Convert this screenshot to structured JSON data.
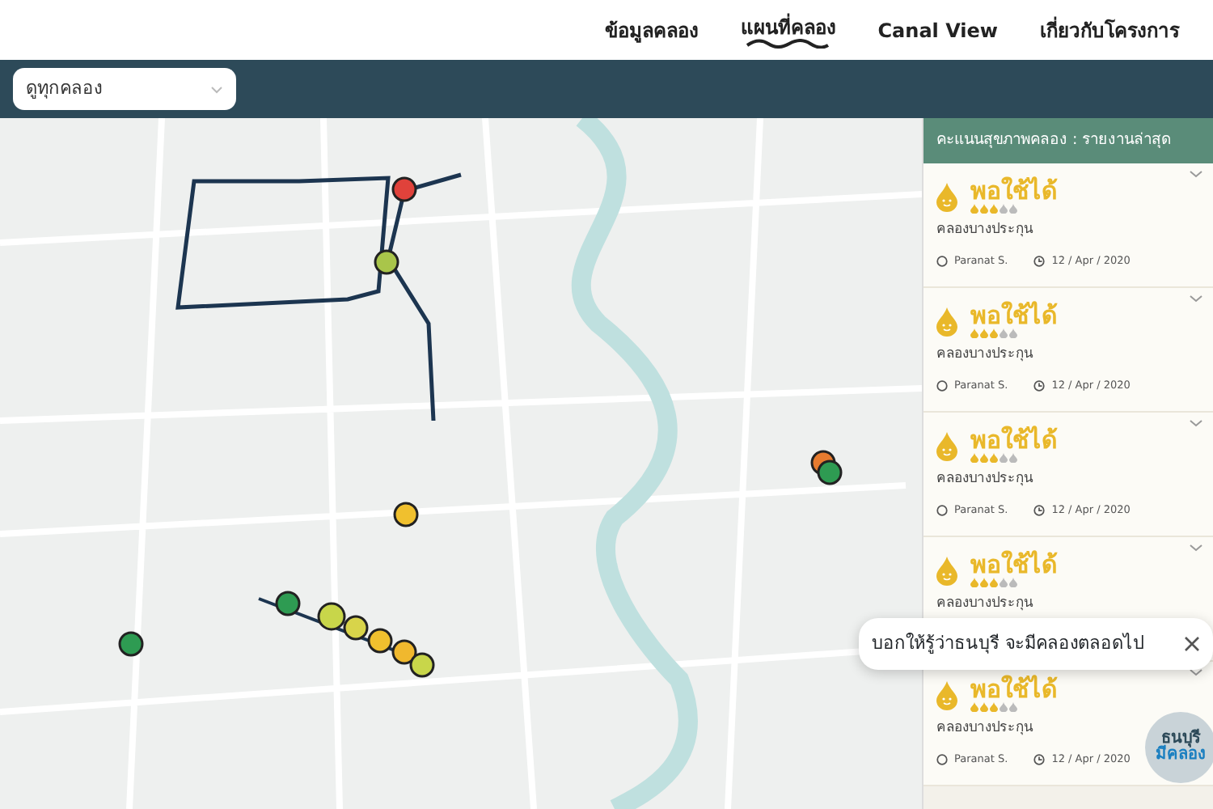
{
  "nav": {
    "items": [
      {
        "label": "ข้อมูลคลอง",
        "selected": false
      },
      {
        "label": "แผนที่คลอง",
        "selected": true
      },
      {
        "label": "Canal View",
        "selected": false
      },
      {
        "label": "เกี่ยวกับโครงการ",
        "selected": false
      }
    ]
  },
  "filter": {
    "value": "ดูทุกคลอง"
  },
  "panel": {
    "title": "คะแนนสุขภาพคลอง : รายงานล่าสุด",
    "reports": [
      {
        "status": "พอใช้ได้",
        "stars": 3,
        "canal": "คลองบางประกุน",
        "user": "Paranat S.",
        "date": "12 / Apr / 2020"
      },
      {
        "status": "พอใช้ได้",
        "stars": 3,
        "canal": "คลองบางประกุน",
        "user": "Paranat S.",
        "date": "12 / Apr / 2020"
      },
      {
        "status": "พอใช้ได้",
        "stars": 3,
        "canal": "คลองบางประกุน",
        "user": "Paranat S.",
        "date": "12 / Apr / 2020"
      },
      {
        "status": "พอใช้ได้",
        "stars": 3,
        "canal": "คลองบางประกุน"
      },
      {
        "status": "พอใช้ได้",
        "stars": 3,
        "canal": "คลองบางประกุน",
        "user": "Paranat S.",
        "date": "12 / Apr / 2020"
      }
    ]
  },
  "toast": {
    "message": "บอกให้รู้ว่าธนบุรี จะมีคลองตลอดไป"
  },
  "logo": {
    "line_1": "ธนบุรี",
    "line_2": "มีคลอง"
  }
}
